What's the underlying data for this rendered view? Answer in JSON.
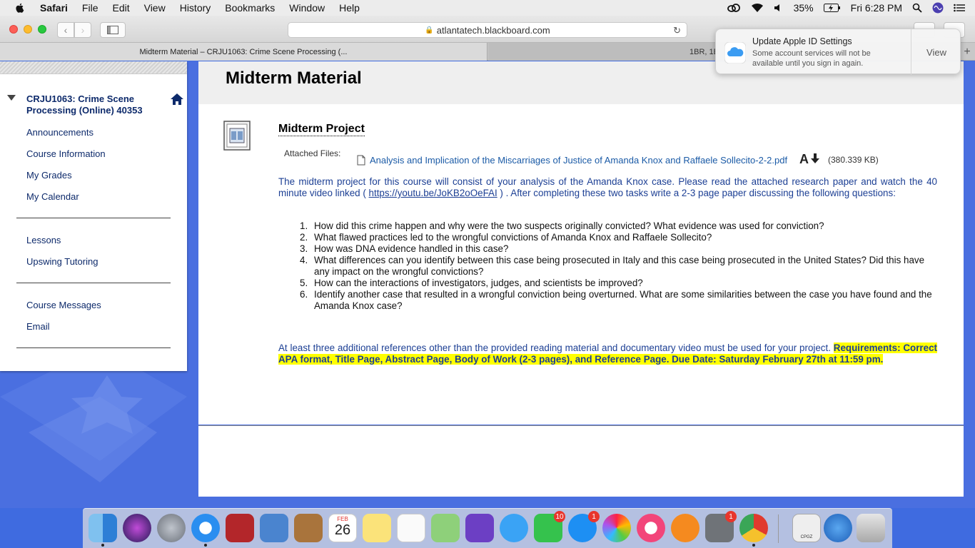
{
  "menubar": {
    "app_name": "Safari",
    "items": [
      "File",
      "Edit",
      "View",
      "History",
      "Bookmarks",
      "Window",
      "Help"
    ],
    "battery": "35%",
    "clock": "Fri 6:28 PM"
  },
  "browser": {
    "url": "atlantatech.blackboard.com",
    "tabs": [
      {
        "title": "Midterm Material – CRJU1063: Crime Scene Processing (..."
      },
      {
        "title": "1BR, 1B"
      }
    ]
  },
  "notification": {
    "title": "Update Apple ID Settings",
    "body": "Some account services will not be available until you sign in again.",
    "button": "View"
  },
  "course_nav": {
    "course_title": "CRJU1063: Crime Scene Processing (Online) 40353",
    "group1": [
      "Announcements",
      "Course Information",
      "My Grades",
      "My Calendar"
    ],
    "group2": [
      "Lessons",
      "Upswing Tutoring"
    ],
    "group3": [
      "Course Messages",
      "Email"
    ]
  },
  "content": {
    "page_title": "Midterm Material",
    "item_title": "Midterm Project",
    "attached_label": "Attached Files:",
    "file_name": "Analysis and Implication of the Miscarriages of Justice of Amanda Knox and Raffaele Sollecito-2-2.pdf",
    "file_size": "(380.339 KB)",
    "intro_before_link": "The midterm project for this course will consist of your analysis of the Amanda Knox case. Please read the attached research paper and watch the 40 minute video linked ( ",
    "video_link": "https://youtu.be/JoKB2oOeFAI",
    "intro_after_link": " ) . After completing these two tasks write a 2-3 page paper discussing the following questions:",
    "questions": [
      {
        "num": "1.",
        "text": "How did this crime happen and why were the two suspects originally convicted? What evidence was used for conviction?"
      },
      {
        "num": "2.",
        "text": "What flawed practices led to the wrongful convictions of Amanda Knox and Raffaele Sollecito?"
      },
      {
        "num": "3.",
        "text": "How was DNA evidence handled in this case?"
      },
      {
        "num": "4.",
        "text": "What differences can you identify between this case being prosecuted in Italy and this case being prosecuted in the United States? Did this have any impact on the wrongful convictions?"
      },
      {
        "num": "5.",
        "text": "How can the interactions of investigators, judges, and scientists be improved?"
      },
      {
        "num": "6.",
        "text": "Identify another case that resulted in a wrongful conviction being overturned. What are some similarities between the case you have found and the Amanda Knox case?"
      }
    ],
    "references_text": "At least three additional references other than the provided reading material and documentary video must be used for your project. ",
    "requirements_text": "Requirements: Correct APA format, Title Page, Abstract Page, Body of Work (2-3 pages), and Reference Page. Due Date: Saturday February 27th at 11:59 pm."
  },
  "dock": {
    "calendar_month": "FEB",
    "calendar_day": "26",
    "facetime_badge": "10",
    "appstore_badge": "1",
    "prefs_badge": "1",
    "file_label": "CPGZ"
  },
  "colors": {
    "link_blue": "#1c3f94",
    "highlight": "#ffff00",
    "desktop_blue": "#4a6fe0"
  }
}
